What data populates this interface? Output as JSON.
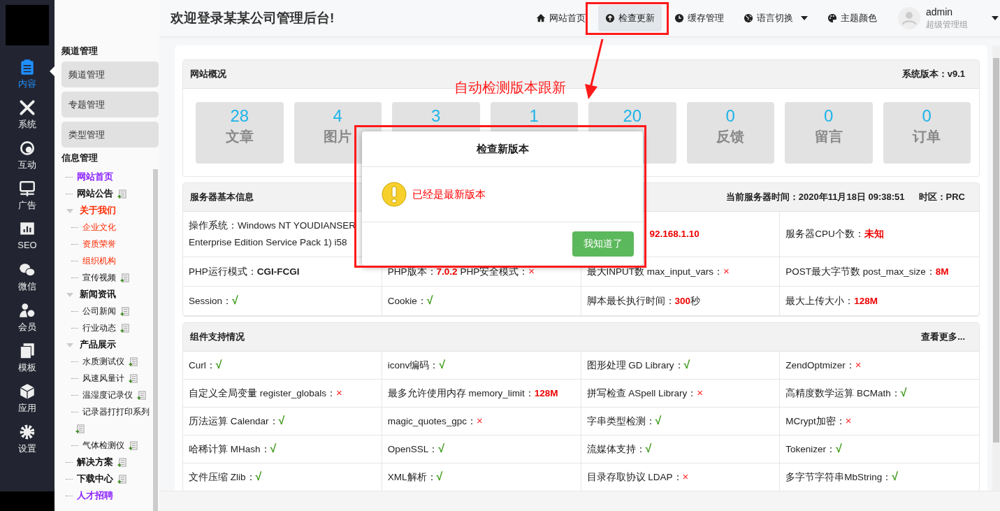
{
  "header": {
    "title": "欢迎登录某某公司管理后台!",
    "nav": [
      {
        "label": "网站首页",
        "selected": false
      },
      {
        "label": "检查更新",
        "selected": true
      },
      {
        "label": "缓存管理",
        "selected": false
      },
      {
        "label": "语言切换",
        "selected": false,
        "dropdown": true
      },
      {
        "label": "主题颜色",
        "selected": false
      }
    ],
    "user": {
      "name": "admin",
      "role": "超级管理组"
    }
  },
  "rail": [
    {
      "label": "内容",
      "selected": true
    },
    {
      "label": "系统",
      "selected": false
    },
    {
      "label": "互动",
      "selected": false
    },
    {
      "label": "广告",
      "selected": false
    },
    {
      "label": "SEO",
      "selected": false
    },
    {
      "label": "微信",
      "selected": false
    },
    {
      "label": "会员",
      "selected": false
    },
    {
      "label": "模板",
      "selected": false
    },
    {
      "label": "应用",
      "selected": false
    },
    {
      "label": "设置",
      "selected": false
    }
  ],
  "channel_menu": {
    "heading": "频道管理",
    "buttons": [
      "频道管理",
      "专题管理",
      "类型管理"
    ]
  },
  "info_menu": {
    "heading": "信息管理",
    "tree": [
      {
        "label": "网站首页",
        "kind": "link",
        "bold": true,
        "addable": false
      },
      {
        "label": "网站公告",
        "kind": "normal",
        "bold": true,
        "addable": true
      },
      {
        "label": "关于我们",
        "kind": "current",
        "bold": true,
        "addable": false,
        "expanded": true,
        "children": [
          {
            "label": "企业文化",
            "kind": "current",
            "bold": false,
            "addable": false
          },
          {
            "label": "资质荣誉",
            "kind": "current",
            "bold": false,
            "addable": false
          },
          {
            "label": "组织机构",
            "kind": "current",
            "bold": false,
            "addable": false
          },
          {
            "label": "宣传视频",
            "kind": "normal",
            "bold": false,
            "addable": true
          }
        ]
      },
      {
        "label": "新闻资讯",
        "kind": "normal",
        "bold": true,
        "addable": false,
        "expanded": true,
        "children": [
          {
            "label": "公司新闻",
            "kind": "normal",
            "bold": false,
            "addable": true
          },
          {
            "label": "行业动态",
            "kind": "normal",
            "bold": false,
            "addable": true
          }
        ]
      },
      {
        "label": "产品展示",
        "kind": "normal",
        "bold": true,
        "addable": false,
        "expanded": true,
        "children": [
          {
            "label": "水质测试仪",
            "kind": "normal",
            "bold": false,
            "addable": true
          },
          {
            "label": "风速风量计",
            "kind": "normal",
            "bold": false,
            "addable": true
          },
          {
            "label": "温湿度记录仪",
            "kind": "normal",
            "bold": false,
            "addable": true
          },
          {
            "label": "记录器打打印系列",
            "kind": "normal",
            "bold": false,
            "addable": true
          },
          {
            "label": "气体检测仪",
            "kind": "normal",
            "bold": false,
            "addable": true
          }
        ]
      },
      {
        "label": "解决方案",
        "kind": "normal",
        "bold": true,
        "addable": true
      },
      {
        "label": "下载中心",
        "kind": "normal",
        "bold": true,
        "addable": true
      },
      {
        "label": "人才招聘",
        "kind": "link",
        "bold": true,
        "addable": false
      }
    ]
  },
  "overview": {
    "title": "网站概况",
    "version": "系统版本：v9.1",
    "stats": [
      {
        "value": "28",
        "label": "文章"
      },
      {
        "value": "4",
        "label": "图片"
      },
      {
        "value": "3"
      },
      {
        "value": "1"
      },
      {
        "value": "20"
      },
      {
        "value": "0",
        "label": "反馈"
      },
      {
        "value": "0",
        "label": "留言"
      },
      {
        "value": "0",
        "label": "订单"
      }
    ]
  },
  "server": {
    "title": "服务器基本信息",
    "time": "当前服务器时间：2020年11月18日 09:38:51",
    "timezone": "时区：PRC",
    "rows": [
      [
        {
          "label": "操作系统：Windows NT YOUDIANSER\nEnterprise Edition Service Pack 1) i58"
        },
        {},
        {
          "value": "92.168.1.10",
          "kind": "red"
        },
        {
          "label": "服务器CPU个数：",
          "value": "未知",
          "kind": "red"
        }
      ],
      [
        {
          "label": "PHP运行模式：",
          "value": "CGI-FCGI",
          "kind": "bold"
        },
        {
          "label": "PHP版本：",
          "value": "7.0.2",
          "kind": "red",
          "label2": "PHP安全模式：",
          "value2": "×"
        },
        {
          "label": "最大INPUT数 max_input_vars：",
          "value": "×",
          "kind": "cross"
        },
        {
          "label": "POST最大字节数 post_max_size：",
          "value": "8M",
          "kind": "red"
        }
      ],
      [
        {
          "label": "Session：",
          "value": "√",
          "kind": "check"
        },
        {
          "label": "Cookie：",
          "value": "√",
          "kind": "check"
        },
        {
          "label": "脚本最长执行时间：",
          "value": "300",
          "kind": "red",
          "suffix": "秒"
        },
        {
          "label": "最大上传大小：",
          "value": "128M",
          "kind": "red"
        }
      ]
    ]
  },
  "components": {
    "title": "组件支持情况",
    "more": "查看更多...",
    "rows": [
      [
        {
          "label": "Curl：",
          "value": "√",
          "kind": "check"
        },
        {
          "label": "iconv编码：",
          "value": "√",
          "kind": "check"
        },
        {
          "label": "图形处理 GD Library：",
          "value": "√",
          "kind": "check"
        },
        {
          "label": "ZendOptmizer：",
          "value": "×",
          "kind": "cross"
        }
      ],
      [
        {
          "label": "自定义全局变量 register_globals：",
          "value": "×",
          "kind": "cross"
        },
        {
          "label": "最多允许使用内存 memory_limit：",
          "value": "128M",
          "kind": "red"
        },
        {
          "label": "拼写检查 ASpell Library：",
          "value": "×",
          "kind": "cross"
        },
        {
          "label": "高精度数学运算 BCMath：",
          "value": "√",
          "kind": "check"
        }
      ],
      [
        {
          "label": "历法运算 Calendar：",
          "value": "√",
          "kind": "check"
        },
        {
          "label": "magic_quotes_gpc：",
          "value": "×",
          "kind": "cross"
        },
        {
          "label": "字串类型检测：",
          "value": "√",
          "kind": "check"
        },
        {
          "label": "MCrypt加密：",
          "value": "×",
          "kind": "cross"
        }
      ],
      [
        {
          "label": "哈稀计算 MHash：",
          "value": "√",
          "kind": "check"
        },
        {
          "label": "OpenSSL：",
          "value": "√",
          "kind": "check"
        },
        {
          "label": "流媒体支持：",
          "value": "√",
          "kind": "check"
        },
        {
          "label": "Tokenizer：",
          "value": "√",
          "kind": "check"
        }
      ],
      [
        {
          "label": "文件压缩 Zlib：",
          "value": "√",
          "kind": "check"
        },
        {
          "label": "XML解析：",
          "value": "√",
          "kind": "check"
        },
        {
          "label": "目录存取协议 LDAP：",
          "value": "×",
          "kind": "cross"
        },
        {
          "label": "多字节字符串MbString：",
          "value": "√",
          "kind": "check"
        }
      ]
    ]
  },
  "dialog": {
    "title": "检查新版本",
    "message": "已经是最新版本",
    "button": "我知道了"
  },
  "annotation": {
    "text": "自动检测版本跟新"
  }
}
